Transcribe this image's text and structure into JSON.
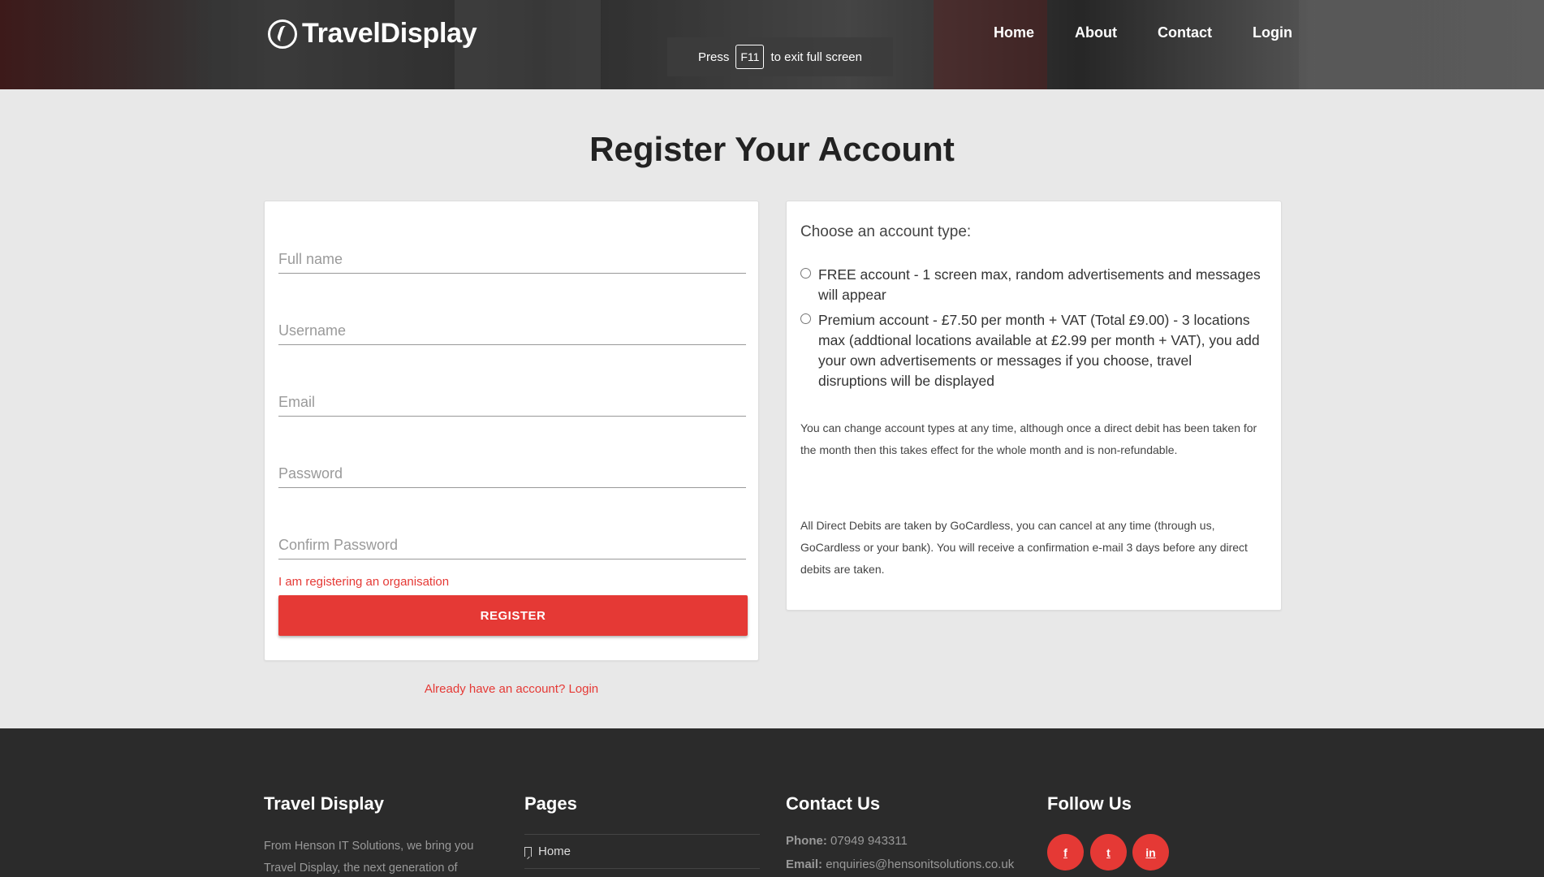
{
  "header": {
    "logo_text": "TravelDisplay",
    "nav": [
      "Home",
      "About",
      "Contact",
      "Login"
    ],
    "fullscreen_notice": {
      "prefix": "Press",
      "key": "F11",
      "suffix": "to exit full screen"
    }
  },
  "main": {
    "title": "Register Your Account",
    "form": {
      "placeholders": {
        "full_name": "Full name",
        "username": "Username",
        "email": "Email",
        "password": "Password",
        "confirm_password": "Confirm Password"
      },
      "organisation_link": "I am registering an organisation",
      "register_label": "REGISTER",
      "login_link": "Already have an account? Login"
    },
    "account": {
      "heading": "Choose an account type:",
      "options": [
        "FREE account - 1 screen max, random advertisements and messages will appear",
        "Premium account - £7.50 per month + VAT (Total £9.00) - 3 locations max (addtional locations available at £2.99 per month + VAT), you add your own advertisements or messages if you choose, travel disruptions will be displayed"
      ],
      "notes": [
        "You can change account types at any time, although once a direct debit has been taken for the month then this takes effect for the whole month and is non-refundable.",
        "All Direct Debits are taken by GoCardless, you can cancel at any time (through us, GoCardless or your bank). You will receive a confirmation e-mail 3 days before any direct debits are taken."
      ]
    }
  },
  "footer": {
    "about": {
      "heading": "Travel Display",
      "text": "From Henson IT Solutions, we bring you Travel Display, the next generation of"
    },
    "pages": {
      "heading": "Pages",
      "items": [
        "Home"
      ]
    },
    "contact": {
      "heading": "Contact Us",
      "phone_label": "Phone:",
      "phone": "07949 943311",
      "email_label": "Email:",
      "email": "enquiries@hensonitsolutions.co.uk"
    },
    "follow": {
      "heading": "Follow Us",
      "icons": [
        "facebook-icon",
        "twitter-icon",
        "linkedin-icon"
      ],
      "glyphs": [
        "f",
        "t",
        "in"
      ]
    }
  },
  "colors": {
    "accent": "#e53935",
    "footer_bg": "#2b2b2b",
    "page_bg": "#e8e8e8"
  }
}
